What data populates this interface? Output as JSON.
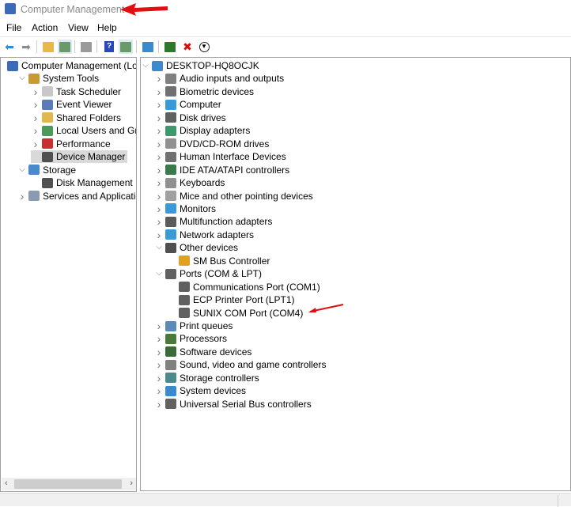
{
  "window": {
    "title": "Computer Management",
    "title_icon": "computer-management-icon"
  },
  "menu": [
    "File",
    "Action",
    "View",
    "Help"
  ],
  "toolbar": [
    {
      "icon": "back-arrow-icon",
      "color": "#2f8fd8"
    },
    {
      "icon": "forward-arrow-icon",
      "color": "#8a8a8a"
    },
    {
      "icon": "up-folder-icon",
      "color": "#e8b84a"
    },
    {
      "icon": "show-hide-console-tree-icon",
      "color": "#6a9a6a",
      "selected": true
    },
    {
      "icon": "properties-icon",
      "color": "#9a9a9a"
    },
    {
      "icon": "help-icon",
      "color": "#2a48b8"
    },
    {
      "icon": "show-action-pane-icon",
      "color": "#6a9a6a",
      "selected": true
    },
    {
      "icon": "scan-hardware-icon",
      "color": "#3a8ad0"
    },
    {
      "icon": "update-driver-icon",
      "color": "#2a7a2a"
    },
    {
      "icon": "uninstall-icon",
      "color": "#d01010"
    },
    {
      "icon": "download-icon",
      "color": "#222222"
    }
  ],
  "left_tree": [
    {
      "label": "Computer Management (Local",
      "level": 0,
      "chevron": "",
      "icon": "computer-management-icon",
      "color": "#3a6ab8"
    },
    {
      "label": "System Tools",
      "level": 1,
      "chevron": "down",
      "icon": "tools-icon",
      "color": "#c89a30"
    },
    {
      "label": "Task Scheduler",
      "level": 2,
      "chevron": "right",
      "icon": "clock-icon",
      "color": "#c8c8c8"
    },
    {
      "label": "Event Viewer",
      "level": 2,
      "chevron": "right",
      "icon": "event-viewer-icon",
      "color": "#5a7ab8"
    },
    {
      "label": "Shared Folders",
      "level": 2,
      "chevron": "right",
      "icon": "shared-folder-icon",
      "color": "#e0b850"
    },
    {
      "label": "Local Users and Groups",
      "level": 2,
      "chevron": "right",
      "icon": "users-icon",
      "color": "#4a9a5a"
    },
    {
      "label": "Performance",
      "level": 2,
      "chevron": "right",
      "icon": "performance-icon",
      "color": "#c83030"
    },
    {
      "label": "Device Manager",
      "level": 2,
      "chevron": "",
      "icon": "device-manager-icon",
      "color": "#505050",
      "selected": true
    },
    {
      "label": "Storage",
      "level": 1,
      "chevron": "down",
      "icon": "storage-icon",
      "color": "#4a8ac8"
    },
    {
      "label": "Disk Management",
      "level": 2,
      "chevron": "",
      "icon": "disk-icon",
      "color": "#505050"
    },
    {
      "label": "Services and Applications",
      "level": 1,
      "chevron": "right",
      "icon": "services-icon",
      "color": "#8a9ab0"
    }
  ],
  "right_tree": [
    {
      "label": "DESKTOP-HQ8OCJK",
      "level": 0,
      "chevron": "down",
      "icon": "computer-icon",
      "color": "#3a8ad0"
    },
    {
      "label": "Audio inputs and outputs",
      "level": 1,
      "chevron": "right",
      "icon": "speaker-icon",
      "color": "#808080"
    },
    {
      "label": "Biometric devices",
      "level": 1,
      "chevron": "right",
      "icon": "biometric-icon",
      "color": "#707070"
    },
    {
      "label": "Computer",
      "level": 1,
      "chevron": "right",
      "icon": "computer-icon",
      "color": "#3a9ad8"
    },
    {
      "label": "Disk drives",
      "level": 1,
      "chevron": "right",
      "icon": "disk-drive-icon",
      "color": "#606060"
    },
    {
      "label": "Display adapters",
      "level": 1,
      "chevron": "right",
      "icon": "display-adapter-icon",
      "color": "#3a9a6a"
    },
    {
      "label": "DVD/CD-ROM drives",
      "level": 1,
      "chevron": "right",
      "icon": "dvd-icon",
      "color": "#909090"
    },
    {
      "label": "Human Interface Devices",
      "level": 1,
      "chevron": "right",
      "icon": "hid-icon",
      "color": "#707070"
    },
    {
      "label": "IDE ATA/ATAPI controllers",
      "level": 1,
      "chevron": "right",
      "icon": "ide-controller-icon",
      "color": "#3a7a4a"
    },
    {
      "label": "Keyboards",
      "level": 1,
      "chevron": "right",
      "icon": "keyboard-icon",
      "color": "#909090"
    },
    {
      "label": "Mice and other pointing devices",
      "level": 1,
      "chevron": "right",
      "icon": "mouse-icon",
      "color": "#a0a0a0"
    },
    {
      "label": "Monitors",
      "level": 1,
      "chevron": "right",
      "icon": "monitor-icon",
      "color": "#3a9ad8"
    },
    {
      "label": "Multifunction adapters",
      "level": 1,
      "chevron": "right",
      "icon": "multifunction-icon",
      "color": "#5a5a5a"
    },
    {
      "label": "Network adapters",
      "level": 1,
      "chevron": "right",
      "icon": "network-icon",
      "color": "#3a9ad8"
    },
    {
      "label": "Other devices",
      "level": 1,
      "chevron": "down",
      "icon": "unknown-device-icon",
      "color": "#505050"
    },
    {
      "label": "SM Bus Controller",
      "level": 2,
      "chevron": "",
      "icon": "warning-device-icon",
      "color": "#e0a020"
    },
    {
      "label": "Ports (COM & LPT)",
      "level": 1,
      "chevron": "down",
      "icon": "port-icon",
      "color": "#606060"
    },
    {
      "label": "Communications Port (COM1)",
      "level": 2,
      "chevron": "",
      "icon": "port-icon",
      "color": "#606060"
    },
    {
      "label": "ECP Printer Port (LPT1)",
      "level": 2,
      "chevron": "",
      "icon": "port-icon",
      "color": "#606060"
    },
    {
      "label": "SUNIX COM Port (COM4)",
      "level": 2,
      "chevron": "",
      "icon": "port-icon",
      "color": "#606060"
    },
    {
      "label": "Print queues",
      "level": 1,
      "chevron": "right",
      "icon": "printer-icon",
      "color": "#5a8ab8"
    },
    {
      "label": "Processors",
      "level": 1,
      "chevron": "right",
      "icon": "processor-icon",
      "color": "#4a7a3a"
    },
    {
      "label": "Software devices",
      "level": 1,
      "chevron": "right",
      "icon": "software-device-icon",
      "color": "#3a6a3a"
    },
    {
      "label": "Sound, video and game controllers",
      "level": 1,
      "chevron": "right",
      "icon": "sound-icon",
      "color": "#808080"
    },
    {
      "label": "Storage controllers",
      "level": 1,
      "chevron": "right",
      "icon": "storage-controller-icon",
      "color": "#4a8a8a"
    },
    {
      "label": "System devices",
      "level": 1,
      "chevron": "right",
      "icon": "system-device-icon",
      "color": "#3a8ad0"
    },
    {
      "label": "Universal Serial Bus controllers",
      "level": 1,
      "chevron": "right",
      "icon": "usb-icon",
      "color": "#606060"
    }
  ],
  "annotation_color": "#e01010"
}
